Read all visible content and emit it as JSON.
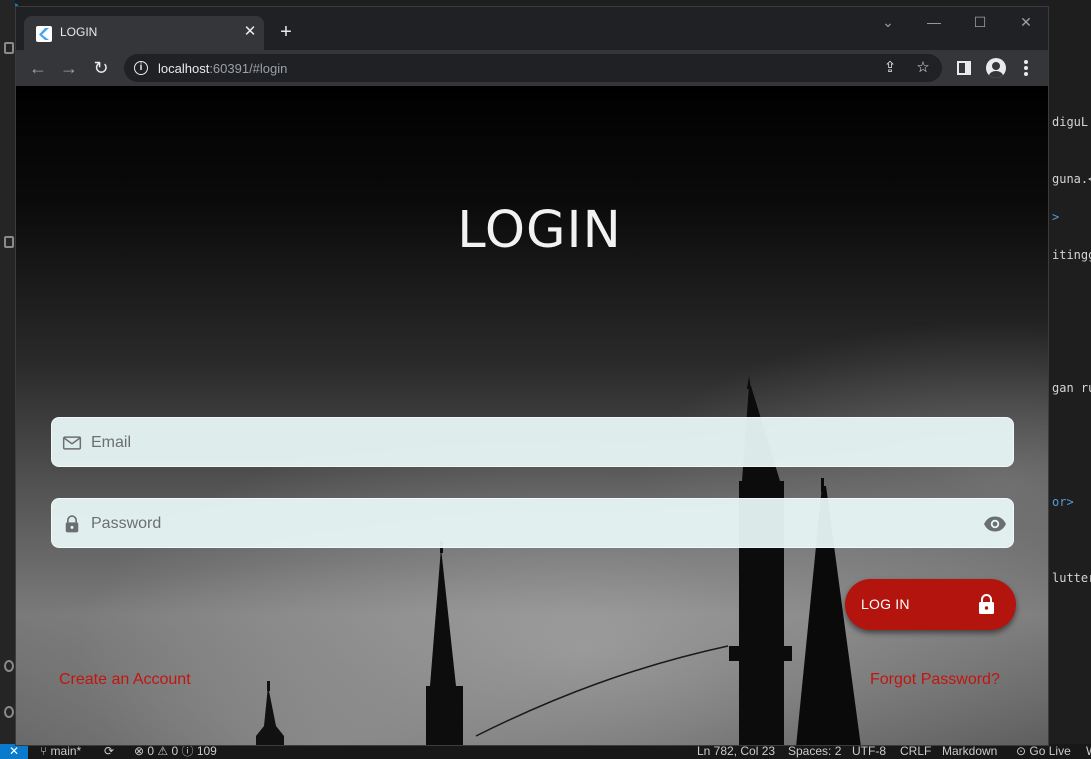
{
  "vscode": {
    "code_fragments": [
      "diguL",
      "guna.<",
      ">",
      "itingg",
      "gan ru",
      "or>",
      "lutter"
    ],
    "statusbar": {
      "branch": "main*",
      "problems": "⊗ 0 ⚠ 0 ⓘ 109",
      "position": "Ln 782, Col 23",
      "spaces": "Spaces: 2",
      "encoding": "UTF-8",
      "eol": "CRLF",
      "language": "Markdown",
      "golive": "Go Live",
      "trailing": "W"
    }
  },
  "browser": {
    "tab_title": "LOGIN",
    "url_host": "localhost",
    "url_rest": ":60391/#login"
  },
  "app": {
    "title": "LOGIN",
    "email_placeholder": "Email",
    "password_placeholder": "Password",
    "login_button": "LOG IN",
    "create_account": "Create an Account",
    "forgot_password": "Forgot Password?",
    "colors": {
      "accent": "#b3140e",
      "link": "#c2150f",
      "field_bg": "#e8f6f6"
    }
  }
}
